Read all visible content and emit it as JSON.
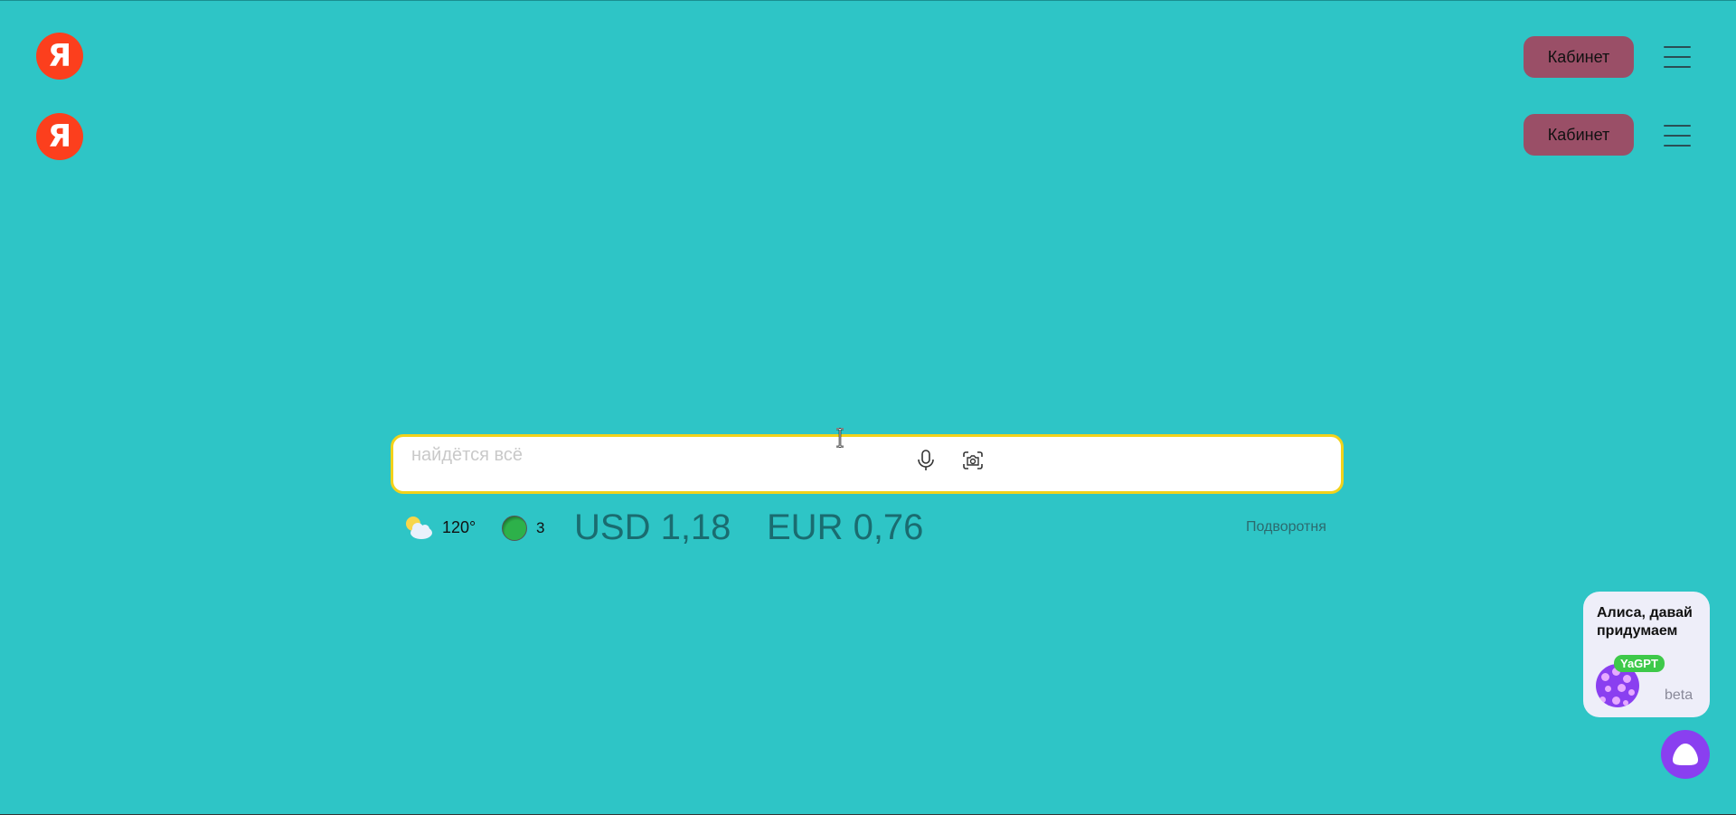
{
  "header": {
    "logo_text": "Я",
    "cabinet_label": "Кабинет"
  },
  "header_duplicate": {
    "logo_text": "Я",
    "cabinet_label": "Кабинет"
  },
  "search": {
    "placeholder": "найдётся всё",
    "value": "",
    "icons": [
      "microphone-icon",
      "camera-icon"
    ]
  },
  "informers": {
    "weather_icon": "partly-cloudy-icon",
    "temperature": "120°",
    "traffic_icon": "traffic-icon",
    "traffic_level": "3",
    "usd": "USD 1,18",
    "eur": "EUR 0,76",
    "location": "Подворотня"
  },
  "alice_promo": {
    "text": "Алиса, давай придумаем",
    "badge": "YaGPT",
    "beta_label": "beta"
  },
  "colors": {
    "background": "#2ec5c6",
    "logo": "#fc3f1d",
    "cabinet_button": "#9a4f67",
    "search_border": "#f2d21b",
    "alice": "#8a3ff0",
    "yagpt_badge": "#3ec94a"
  }
}
